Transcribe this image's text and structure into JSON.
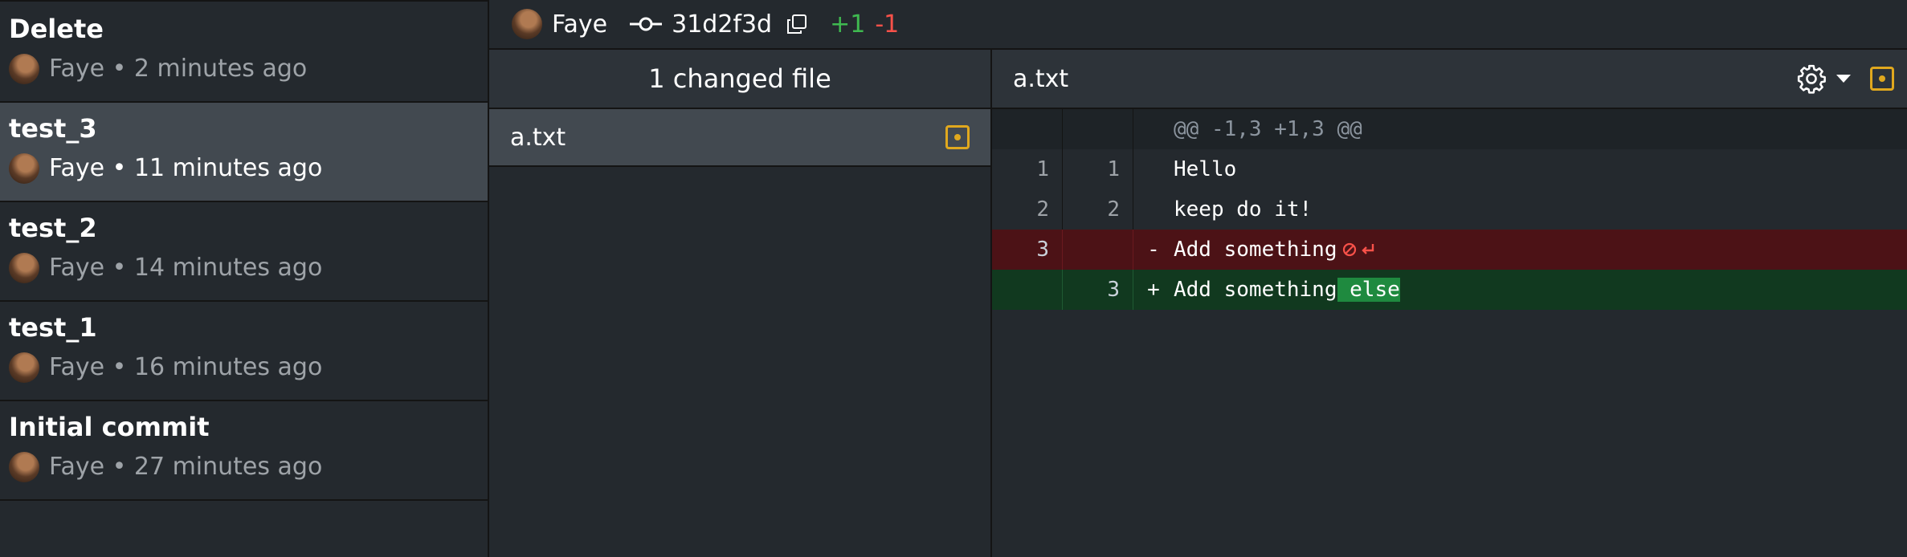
{
  "commits": [
    {
      "title": "Delete",
      "meta": "Faye • 2 minutes ago"
    },
    {
      "title": "test_3",
      "meta": "Faye • 11 minutes ago"
    },
    {
      "title": "test_2",
      "meta": "Faye • 14 minutes ago"
    },
    {
      "title": "test_1",
      "meta": "Faye • 16 minutes ago"
    },
    {
      "title": "Initial commit",
      "meta": "Faye • 27 minutes ago"
    }
  ],
  "topbar": {
    "author": "Faye",
    "sha": "31d2f3d",
    "additions": "+1",
    "deletions": "-1"
  },
  "files": {
    "header": "1 changed file",
    "items": [
      {
        "name": "a.txt",
        "status_icon": "modified-icon"
      }
    ]
  },
  "diff": {
    "filename": "a.txt",
    "hunk": "@@ -1,3 +1,3 @@",
    "lines": [
      {
        "old": "1",
        "new": "1",
        "sign": "",
        "text": "Hello"
      },
      {
        "old": "2",
        "new": "2",
        "sign": "",
        "text": "keep do it!"
      },
      {
        "old": "3",
        "new": "",
        "sign": "-",
        "text": "Add something"
      },
      {
        "old": "",
        "new": "3",
        "sign": "+",
        "text": "Add something",
        "highlight": " else"
      }
    ]
  },
  "colors": {
    "background": "#24292e",
    "selected": "#424950",
    "addition": "#3fb950",
    "deletion": "#f85149",
    "modified": "#e0a81e"
  }
}
